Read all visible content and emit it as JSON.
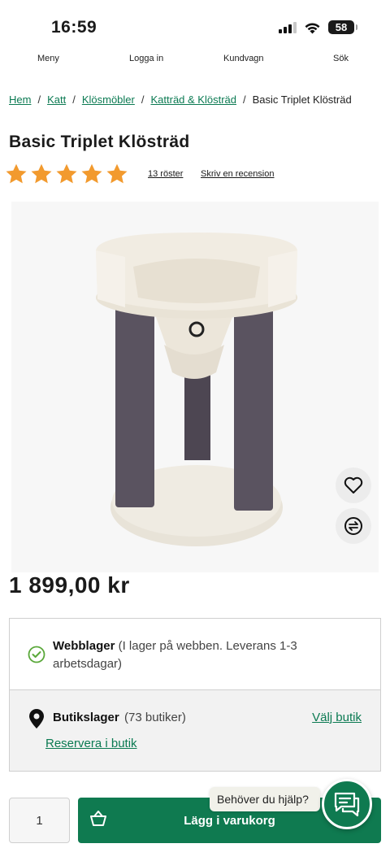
{
  "status_bar": {
    "time": "16:59",
    "battery": "58"
  },
  "nav": {
    "menu": "Meny",
    "login": "Logga in",
    "cart": "Kundvagn",
    "search": "Sök"
  },
  "breadcrumb": {
    "items": [
      "Hem",
      "Katt",
      "Klösmöbler",
      "Katträd & Klösträd"
    ],
    "current": "Basic Triplet Klösträd"
  },
  "product": {
    "title": "Basic Triplet Klösträd",
    "rating": 5,
    "votes": "13 röster",
    "write_review": "Skriv en recension",
    "price": "1 899,00 kr",
    "image_alt": "cat-tree-product-image"
  },
  "stock": {
    "web_label": "Webblager",
    "web_detail": "(I lager på webben. Leverans 1-3 arbetsdagar)",
    "store_label": "Butikslager",
    "store_count": "(73 butiker)",
    "choose_store": "Välj butik",
    "reserve": "Reservera i butik"
  },
  "cart": {
    "quantity": "1",
    "add_label": "Lägg i varukorg"
  },
  "help": {
    "text": "Behöver du hjälp?"
  },
  "colors": {
    "brand_green": "#0f7a50",
    "star": "#f29a2e",
    "link": "#0b7a52"
  }
}
